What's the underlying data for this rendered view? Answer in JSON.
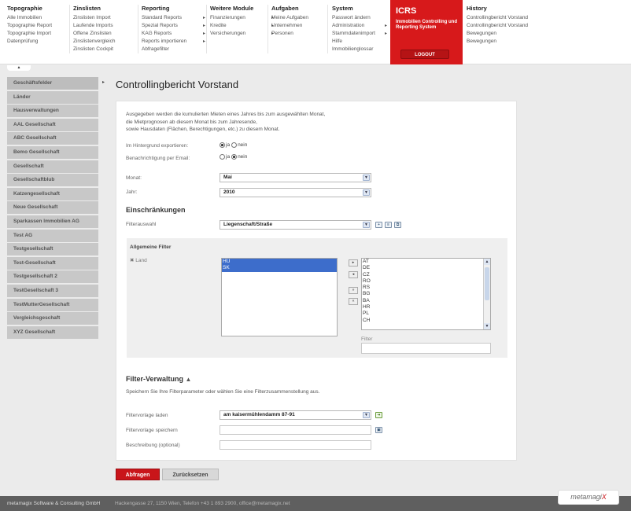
{
  "nav": {
    "columns": [
      {
        "head": "Topographie",
        "items": [
          "Alle Immobilien",
          "Topographie Report",
          "Topographie Import",
          "Datenprüfung"
        ]
      },
      {
        "head": "Zinslisten",
        "items": [
          "Zinslisten Import",
          "Laufende Imports",
          "Offene Zinslisten",
          "Zinslistenvergleich",
          "Zinslisten Cockpit"
        ]
      },
      {
        "head": "Reporting",
        "items": [
          "Standard Reports",
          "Spezial Reports",
          "KAG Reports",
          "Reports importieren",
          "Abfragefilter"
        ]
      },
      {
        "head": "Weitere Module",
        "items": [
          "Finanzierungen",
          "Kredite",
          "Versicherungen"
        ]
      },
      {
        "head": "Aufgaben",
        "items": [
          "Meine Aufgaben",
          "Unternehmen",
          "Personen"
        ]
      },
      {
        "head": "System",
        "items": [
          "Passwort ändern",
          "Administration",
          "Stammdatenimport",
          "Hilfe",
          "Immobilienglossar"
        ]
      }
    ],
    "history": {
      "head": "History",
      "items": [
        "Controllingbericht Vorstand",
        "Controllingbericht Vorstand",
        "Bewegungen",
        "Bewegungen"
      ]
    },
    "brand_box": {
      "title": "ICRS",
      "subtitle": "Immobilien Controlling und Reporting System",
      "logout": "LOGOUT",
      "color": "#d7191b"
    }
  },
  "sidebar": {
    "items": [
      "Geschäftsfelder",
      "Länder",
      "Hausverwaltungen",
      "AAL Gesellschaft",
      "ABC Gesellschaft",
      "Bemo Gesellschaft",
      "Gesellschaft",
      "Gesellschaftblub",
      "Katzengesellschaft",
      "Neue Gesellschaft",
      "Sparkassen Immobilien AG",
      "Test AG",
      "Testgesellschaft",
      "Test-Gesellschaft",
      "Testgesellschaft 2",
      "TestGesellschaft 3",
      "TestMutterGesellschaft",
      "Vergleichsgeschaft",
      "XYZ Gesellschaft"
    ]
  },
  "page": {
    "title": "Controllingbericht Vorstand",
    "description": [
      "Ausgegeben werden die kumulierten Mieten eines Jahres bis zum ausgewählten Monat,",
      "die Mietprognosen ab diesem Monat bis zum Jahresende,",
      "sowie Hausdaten (Flächen, Berechtigungen, etc.) zu diesem Monat."
    ],
    "bg_export_label": "Im Hintergrund exportieren:",
    "email_label": "Benachrichtigung per Email:",
    "ja": "ja",
    "nein": "nein",
    "monat_label": "Monat:",
    "monat_value": "Mai",
    "jahr_label": "Jahr:",
    "jahr_value": "2010",
    "einschraenkungen": "Einschränkungen",
    "filterauswahl_label": "Filterauswahl",
    "filterauswahl_value": "Liegenschaft/Straße",
    "allgemeine_filter": "Allgemeine Filter",
    "land_label": "Land",
    "selected_countries": [
      "HU",
      "SK"
    ],
    "available_countries": [
      "AT",
      "DE",
      "CZ",
      "RO",
      "RS",
      "BG",
      "BA",
      "HR",
      "PL",
      "CH"
    ],
    "filter_label": "Filter",
    "filter_verwaltung": "Filter-Verwaltung",
    "filter_verwaltung_desc": "Speichern Sie Ihre Filterparameter oder wählen Sie eine Filterzusammenstellung aus.",
    "vorlage_laden_label": "Filtervorlage laden",
    "vorlage_laden_value": "am kaisermühlendamm 87-91",
    "vorlage_speichern_label": "Filtervorlage speichern",
    "beschreibung_label": "Beschreibung (optional)"
  },
  "buttons": {
    "abfragen": "Abfragen",
    "zuruecksetzen": "Zurücksetzen"
  },
  "footer": {
    "company": "metamagix Software & Consulting GmbH",
    "address": "Hackengasse 27, 1150 Wien, Telefon +43 1 893 2900, office@metamagix.net",
    "brand_pre": "metamagi",
    "brand_x": "X"
  }
}
